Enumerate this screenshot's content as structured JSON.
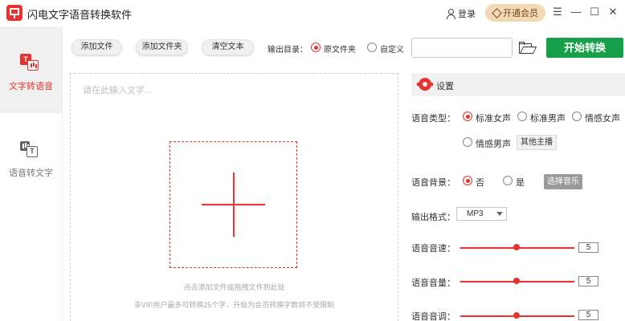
{
  "titlebar": {
    "app_title": "闪电文字语音转换软件",
    "login_label": "登录",
    "vip_label": "开通会员",
    "menu_glyph": "☰",
    "minimize_glyph": "—",
    "maximize_glyph": "☐",
    "close_glyph": "✕"
  },
  "sidebar": {
    "items": [
      {
        "label": "文字转语音",
        "icon": "tts-icon",
        "icon_text": "T",
        "active": true
      },
      {
        "label": "语音转文字",
        "icon": "stt-icon",
        "icon_text": "T",
        "active": false
      }
    ]
  },
  "toolbar": {
    "add_file": "添加文件",
    "add_folder": "添加文件夹",
    "clear_text": "清空文本",
    "output_label": "输出目录：",
    "output_options": [
      "原文件夹",
      "自定义"
    ],
    "output_selected": "原文件夹",
    "output_path": "",
    "start_label": "开始转换"
  },
  "editor": {
    "placeholder": "请在此输入文字...",
    "hint_primary": "点击添加文件或拖拽文件到此处",
    "hint_secondary": "非VIP用户最多可转换25个字，升级为会员转换字数将不受限制"
  },
  "settings": {
    "title": "设置",
    "voice_type_label": "语音类型：",
    "voice_options": [
      "标准女声",
      "标准男声",
      "情感女声",
      "情感男声"
    ],
    "voice_selected": "标准女声",
    "other_voices_label": "其他主播",
    "bg_label": "语音背景：",
    "bg_options": [
      "否",
      "是"
    ],
    "bg_selected": "否",
    "choose_music_label": "选择音乐",
    "format_label": "输出格式：",
    "format_value": "MP3",
    "speed_label": "语音音速：",
    "speed_value": "5",
    "volume_label": "语音音量：",
    "volume_value": "5",
    "pitch_label": "语音音调：",
    "pitch_value": "5"
  },
  "colors": {
    "accent": "#e8322f",
    "start_button": "#15a049",
    "vip_bg": "#f3d9b5"
  }
}
